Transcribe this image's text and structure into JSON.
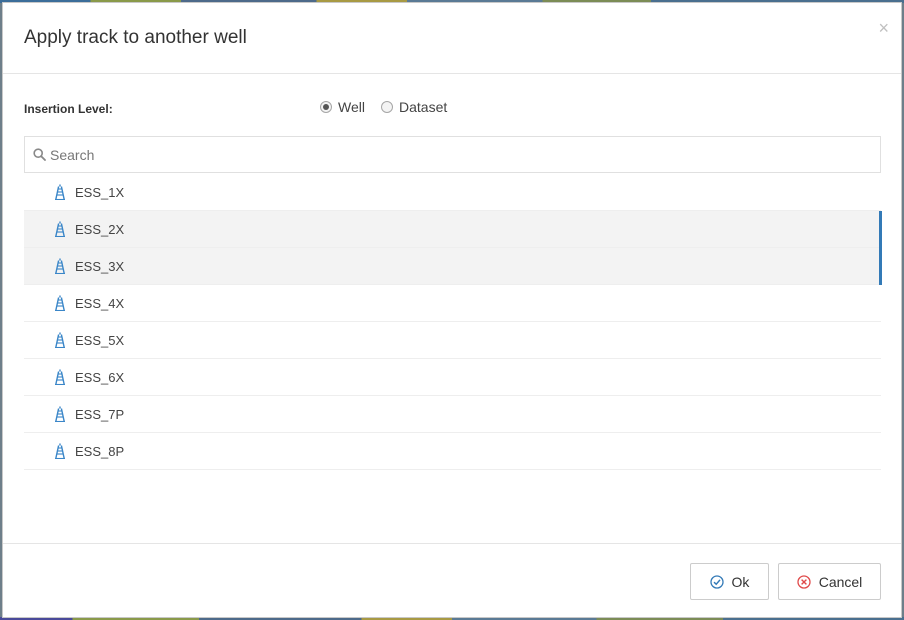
{
  "dialog": {
    "title": "Apply track to another well",
    "close_glyph": "×"
  },
  "insertion": {
    "label": "Insertion Level:",
    "options": [
      {
        "label": "Well",
        "checked": true
      },
      {
        "label": "Dataset",
        "checked": false
      }
    ]
  },
  "search": {
    "placeholder": "Search",
    "icon": "search-icon"
  },
  "wells": [
    {
      "name": "ESS_1X",
      "selected": false,
      "icon": "well-derrick-icon"
    },
    {
      "name": "ESS_2X",
      "selected": true,
      "icon": "well-derrick-icon"
    },
    {
      "name": "ESS_3X",
      "selected": true,
      "icon": "well-derrick-icon"
    },
    {
      "name": "ESS_4X",
      "selected": false,
      "icon": "well-derrick-icon"
    },
    {
      "name": "ESS_5X",
      "selected": false,
      "icon": "well-derrick-icon"
    },
    {
      "name": "ESS_6X",
      "selected": false,
      "icon": "well-derrick-icon"
    },
    {
      "name": "ESS_7P",
      "selected": false,
      "icon": "well-derrick-icon"
    },
    {
      "name": "ESS_8P",
      "selected": false,
      "icon": "well-derrick-icon"
    }
  ],
  "footer": {
    "ok_label": "Ok",
    "cancel_label": "Cancel"
  },
  "colors": {
    "accent": "#337ab7",
    "cancel_icon": "#e04a4a",
    "ok_icon": "#337ab7"
  }
}
